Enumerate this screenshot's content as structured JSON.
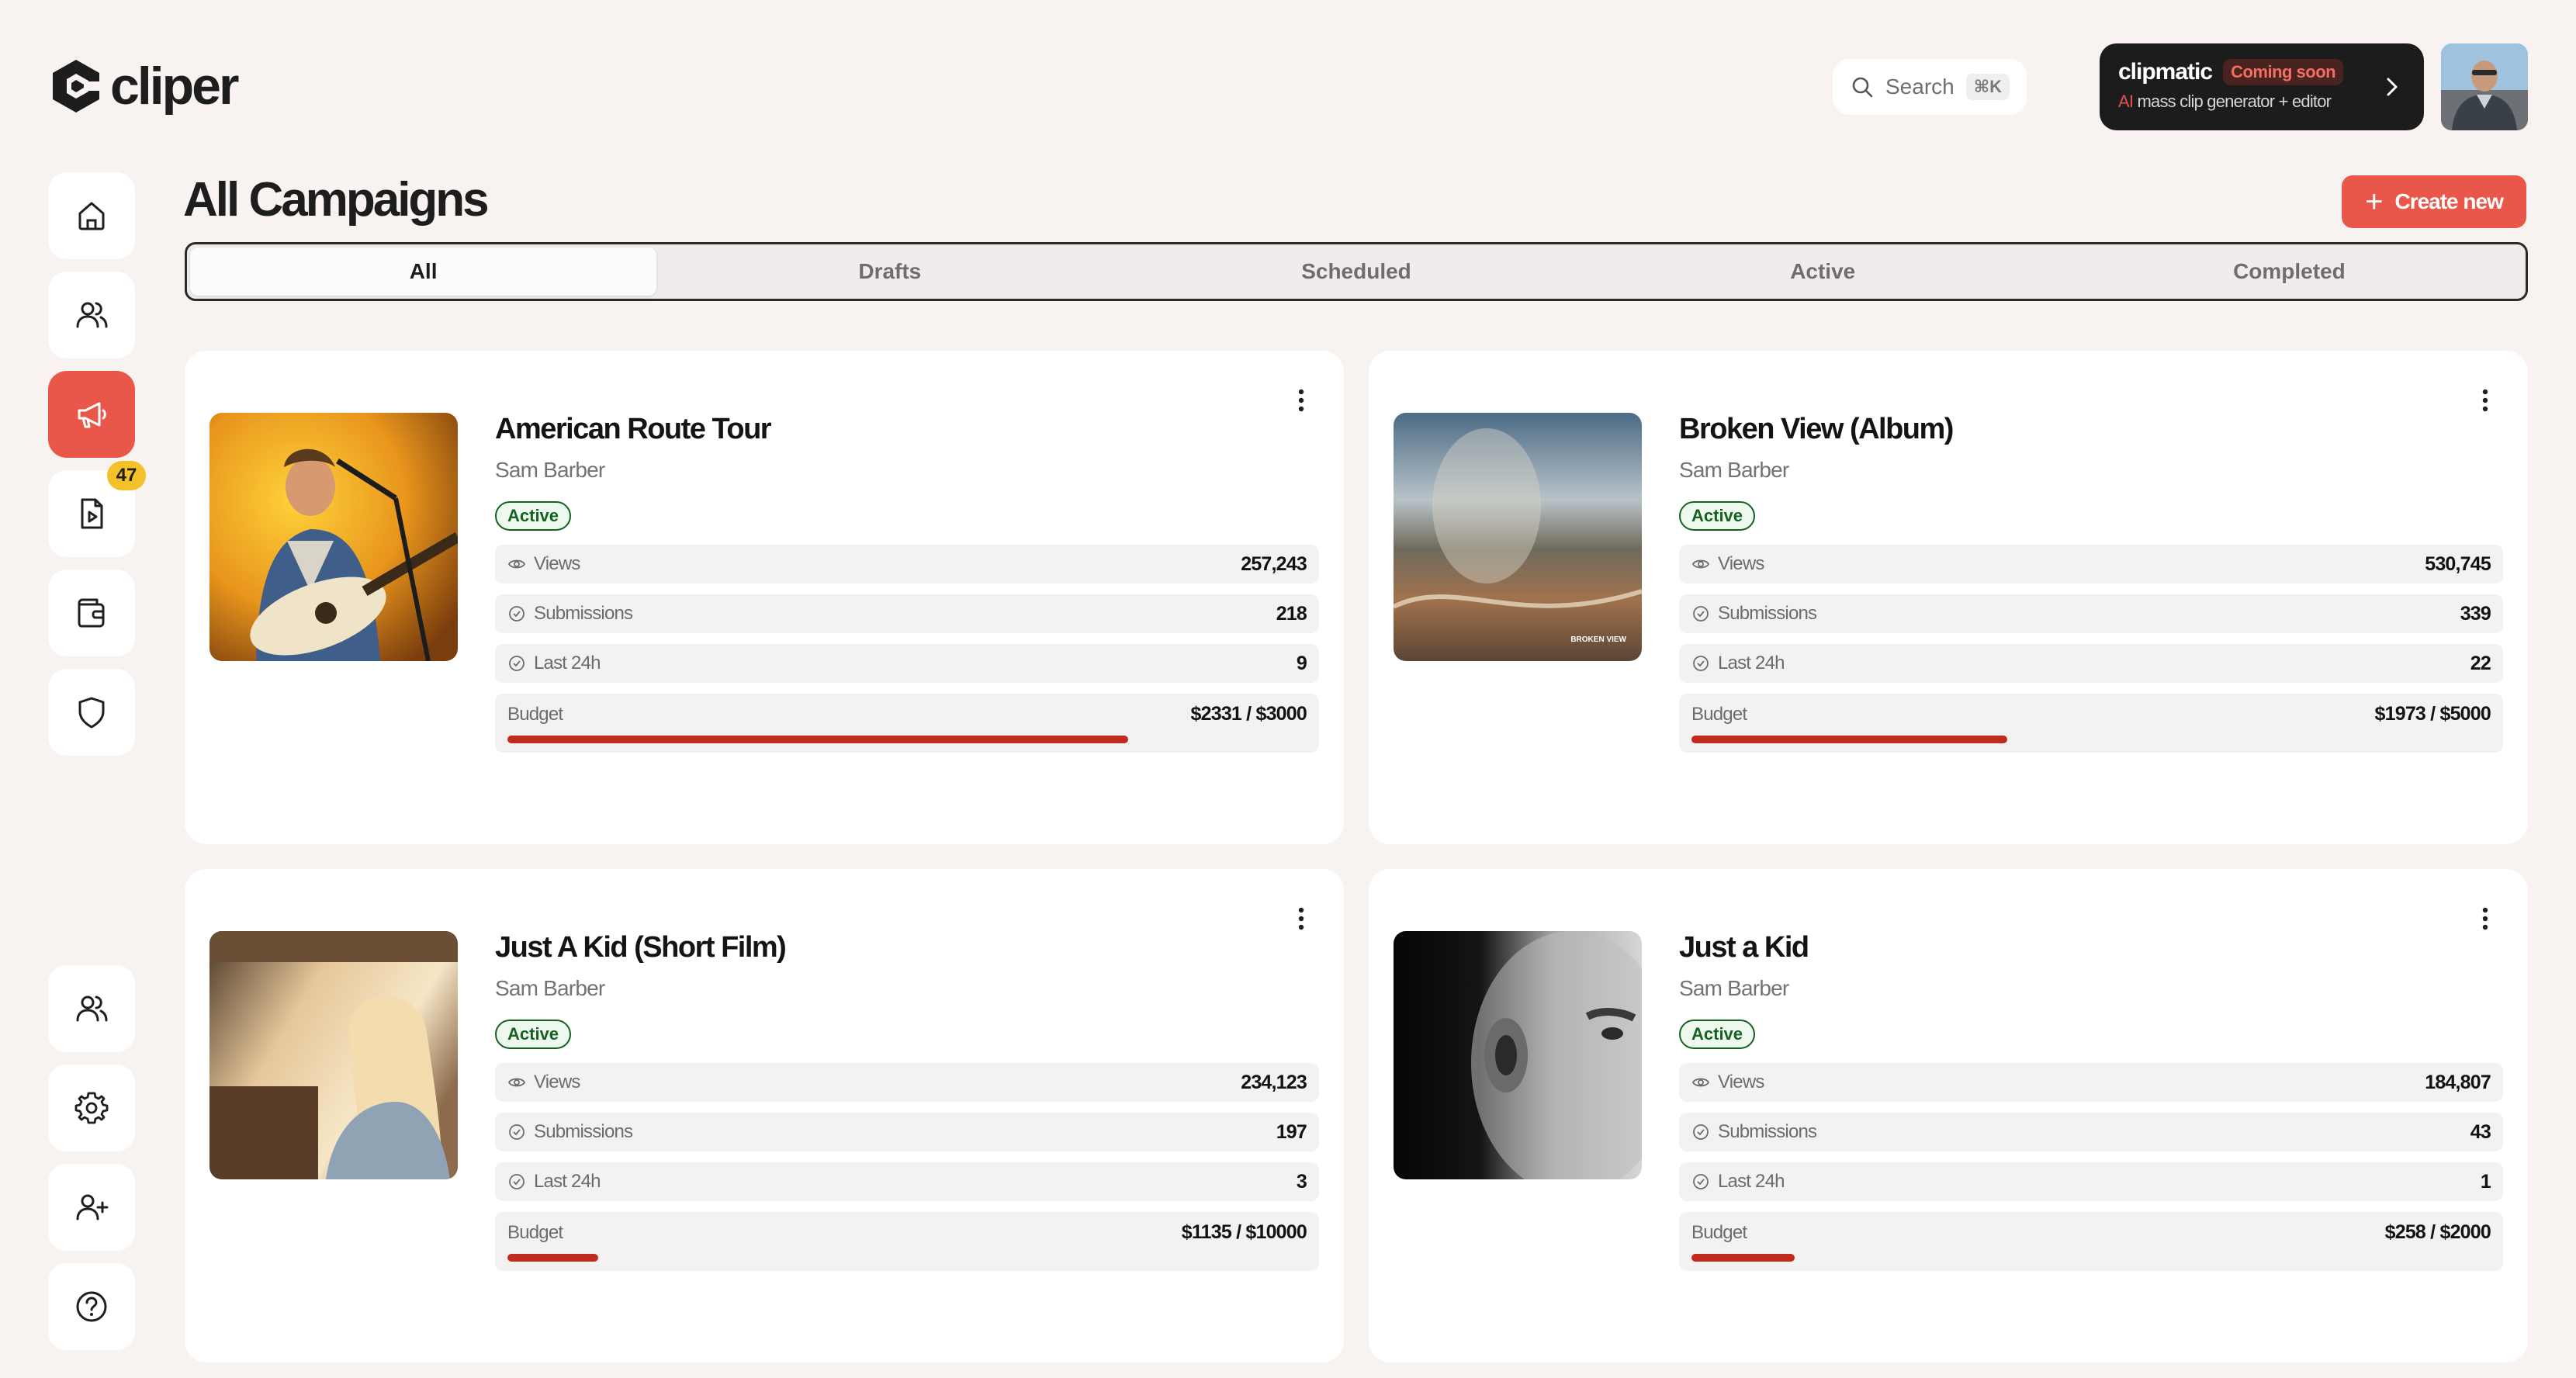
{
  "brand": {
    "name": "cliper",
    "accent": "#e8574a"
  },
  "search": {
    "label": "Search",
    "shortcut": "⌘K"
  },
  "promo": {
    "name": "clipmatic",
    "badge": "Coming soon",
    "ai": "AI",
    "tagline": " mass clip generator + editor"
  },
  "sidebar": {
    "top": [
      {
        "icon": "home-icon",
        "active": false
      },
      {
        "icon": "users-icon",
        "active": false
      },
      {
        "icon": "megaphone-icon",
        "active": true
      },
      {
        "icon": "video-file-icon",
        "active": false,
        "badge": "47"
      },
      {
        "icon": "wallet-icon",
        "active": false
      },
      {
        "icon": "shield-icon",
        "active": false
      }
    ],
    "bottom": [
      {
        "icon": "team-icon"
      },
      {
        "icon": "gear-icon"
      },
      {
        "icon": "add-user-icon"
      },
      {
        "icon": "help-icon"
      }
    ]
  },
  "header": {
    "title": "All Campaigns",
    "create_label": "Create new"
  },
  "tabs": [
    {
      "label": "All",
      "selected": true
    },
    {
      "label": "Drafts",
      "selected": false
    },
    {
      "label": "Scheduled",
      "selected": false
    },
    {
      "label": "Active",
      "selected": false
    },
    {
      "label": "Completed",
      "selected": false
    }
  ],
  "stat_labels": {
    "views": "Views",
    "submissions": "Submissions",
    "last24": "Last 24h",
    "budget": "Budget"
  },
  "campaigns": [
    {
      "title": "American Route Tour",
      "artist": "Sam Barber",
      "status": "Active",
      "views": "257,243",
      "submissions": "218",
      "last24": "9",
      "budget_text": "$2331 / $3000",
      "budget_fraction": 0.777
    },
    {
      "title": "Broken View (Album)",
      "artist": "Sam Barber",
      "status": "Active",
      "views": "530,745",
      "submissions": "339",
      "last24": "22",
      "budget_text": "$1973 / $5000",
      "budget_fraction": 0.395
    },
    {
      "title": "Just A Kid (Short Film)",
      "artist": "Sam Barber",
      "status": "Active",
      "views": "234,123",
      "submissions": "197",
      "last24": "3",
      "budget_text": "$1135 / $10000",
      "budget_fraction": 0.114
    },
    {
      "title": "Just a Kid",
      "artist": "Sam Barber",
      "status": "Active",
      "views": "184,807",
      "submissions": "43",
      "last24": "1",
      "budget_text": "$258 / $2000",
      "budget_fraction": 0.129
    }
  ],
  "album_cover_text": "BROKEN VIEW"
}
